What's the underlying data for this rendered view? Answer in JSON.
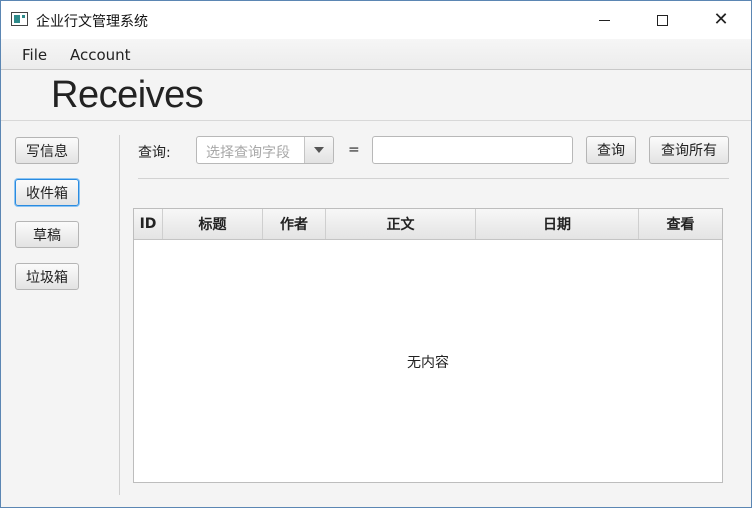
{
  "window": {
    "title": "企业行文管理系统",
    "controls": [
      "minimize-icon",
      "maximize-icon",
      "close-icon"
    ],
    "close_glyph": "✕"
  },
  "menu": {
    "file": "File",
    "account": "Account"
  },
  "header": {
    "title": "Receives"
  },
  "sidebar": {
    "items": [
      {
        "label": "写信息",
        "active": false
      },
      {
        "label": "收件箱",
        "active": true
      },
      {
        "label": "草稿",
        "active": false
      },
      {
        "label": "垃圾箱",
        "active": false
      }
    ]
  },
  "query": {
    "label": "查询:",
    "field_placeholder": "选择查询字段",
    "equals": "=",
    "value": "",
    "search_button": "查询",
    "search_all_button": "查询所有"
  },
  "table": {
    "columns": [
      "ID",
      "标题",
      "作者",
      "正文",
      "日期",
      "查看"
    ],
    "rows": [],
    "empty_text": "无内容"
  },
  "colors": {
    "accent": "#2a8be0",
    "window_border": "#5b86b3",
    "background": "#f4f4f4"
  }
}
